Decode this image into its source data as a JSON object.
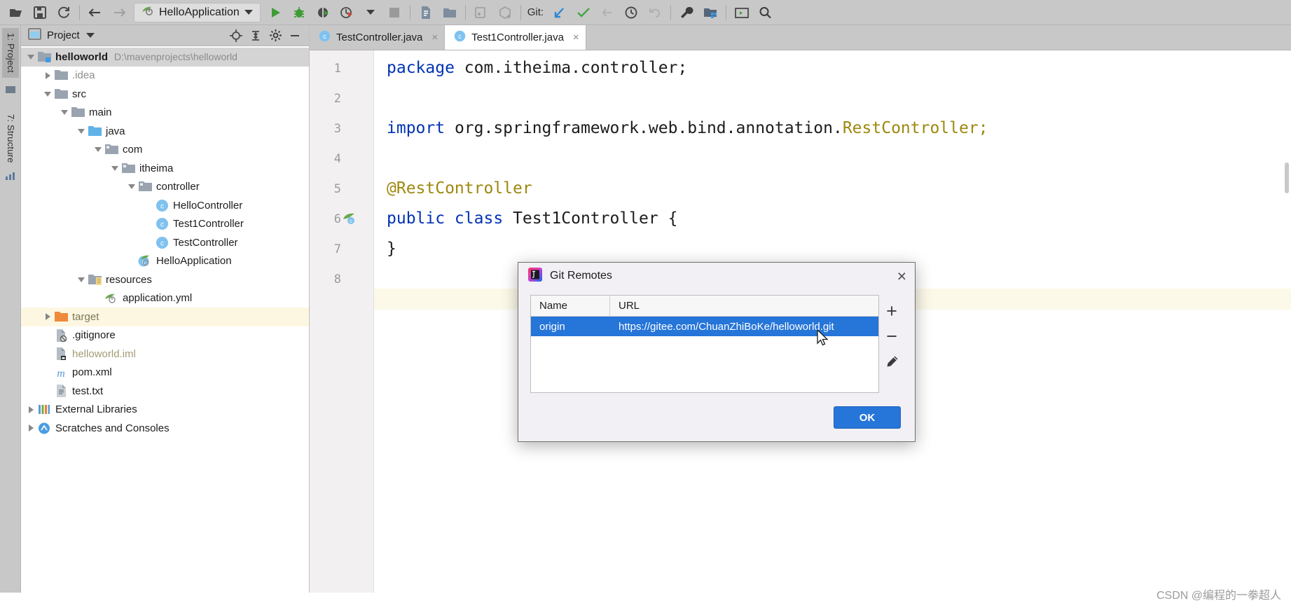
{
  "toolbar": {
    "icons": [
      {
        "name": "open-folder-icon",
        "glyph": "open-folder"
      },
      {
        "name": "save-all-icon",
        "glyph": "floppy"
      },
      {
        "name": "sync-refresh-icon",
        "glyph": "refresh"
      },
      {
        "name": "navigate-back-icon",
        "glyph": "arrow-left"
      },
      {
        "name": "navigate-forward-icon",
        "glyph": "arrow-right"
      }
    ],
    "run_config_name": "HelloApplication",
    "run_config_icon": "spring-boot-icon",
    "run_label": "Run",
    "debug_label": "Debug",
    "coverage_label": "Run with Coverage",
    "profile_label": "Profile",
    "stop_label": "Stop",
    "git_label": "Git:",
    "git_actions": [
      "update-project",
      "commit",
      "push",
      "history",
      "rollback"
    ],
    "right_icons": [
      "settings-wrench-icon",
      "project-structure-icon",
      "terminal-icon",
      "search-icon"
    ]
  },
  "stripe": {
    "project_tab": "1: Project",
    "structure_tab": "7: Structure"
  },
  "project_panel": {
    "header_title": "Project",
    "header_icons": [
      "locate-target-icon",
      "collapse-all-icon",
      "settings-gear-icon",
      "hide-panel-icon"
    ],
    "tree": [
      {
        "depth": 0,
        "twisty": "down",
        "icon": "module-folder-icon",
        "label": "helloworld",
        "bold": true,
        "path": "D:\\mavenprojects\\helloworld",
        "row": "sel-grey"
      },
      {
        "depth": 1,
        "twisty": "right",
        "icon": "folder-icon",
        "label": ".idea",
        "style": "grey"
      },
      {
        "depth": 1,
        "twisty": "down",
        "icon": "folder-icon",
        "label": "src"
      },
      {
        "depth": 2,
        "twisty": "down",
        "icon": "folder-icon",
        "label": "main"
      },
      {
        "depth": 3,
        "twisty": "down",
        "icon": "source-root-icon",
        "label": "java"
      },
      {
        "depth": 4,
        "twisty": "down",
        "icon": "package-icon",
        "label": "com"
      },
      {
        "depth": 5,
        "twisty": "down",
        "icon": "package-icon",
        "label": "itheima"
      },
      {
        "depth": 6,
        "twisty": "down",
        "icon": "package-icon",
        "label": "controller"
      },
      {
        "depth": 7,
        "twisty": "none",
        "icon": "java-class-icon",
        "label": "HelloController"
      },
      {
        "depth": 7,
        "twisty": "none",
        "icon": "java-class-icon",
        "label": "Test1Controller"
      },
      {
        "depth": 7,
        "twisty": "none",
        "icon": "java-class-icon",
        "label": "TestController"
      },
      {
        "depth": 6,
        "twisty": "none",
        "icon": "spring-boot-class-icon",
        "label": "HelloApplication"
      },
      {
        "depth": 3,
        "twisty": "down",
        "icon": "resources-root-icon",
        "label": "resources"
      },
      {
        "depth": 4,
        "twisty": "none",
        "icon": "yaml-spring-icon",
        "label": "application.yml"
      },
      {
        "depth": 1,
        "twisty": "right",
        "icon": "excluded-folder-icon",
        "label": "target",
        "style": "olive",
        "row": "hl-yellow"
      },
      {
        "depth": 1,
        "twisty": "none",
        "icon": "ignored-file-icon",
        "label": ".gitignore"
      },
      {
        "depth": 1,
        "twisty": "none",
        "icon": "iml-file-icon",
        "label": "helloworld.iml",
        "style": "tan"
      },
      {
        "depth": 1,
        "twisty": "none",
        "icon": "maven-pom-icon",
        "label": "pom.xml"
      },
      {
        "depth": 1,
        "twisty": "none",
        "icon": "text-file-icon",
        "label": "test.txt"
      },
      {
        "depth": 0,
        "twisty": "right",
        "icon": "libraries-icon",
        "label": "External Libraries"
      },
      {
        "depth": 0,
        "twisty": "right",
        "icon": "scratches-icon",
        "label": "Scratches and Consoles"
      }
    ]
  },
  "editor": {
    "tabs": [
      {
        "label": "TestController.java",
        "icon": "java-class-icon",
        "active": false,
        "close": "×"
      },
      {
        "label": "Test1Controller.java",
        "icon": "java-class-icon",
        "active": true,
        "close": "×"
      }
    ],
    "line_numbers": [
      "1",
      "2",
      "3",
      "4",
      "5",
      "6",
      "7",
      "8"
    ],
    "gutter_icons": [
      {
        "line": 6,
        "name": "spring-bean-icon"
      }
    ],
    "code_lines": [
      {
        "line": 1,
        "tokens": [
          {
            "t": "package ",
            "c": "kw"
          },
          {
            "t": "com.itheima.controller;",
            "c": "id"
          }
        ]
      },
      {
        "line": 2,
        "tokens": []
      },
      {
        "line": 3,
        "tokens": [
          {
            "t": "import ",
            "c": "kw"
          },
          {
            "t": "org.springframework.web.bind.annotation.",
            "c": "id"
          },
          {
            "t": "RestController;",
            "c": "ann"
          }
        ]
      },
      {
        "line": 4,
        "tokens": []
      },
      {
        "line": 5,
        "tokens": [
          {
            "t": "@RestController",
            "c": "ann"
          }
        ]
      },
      {
        "line": 6,
        "tokens": [
          {
            "t": "public class ",
            "c": "kw"
          },
          {
            "t": "Test1Controller {",
            "c": "id"
          }
        ]
      },
      {
        "line": 7,
        "tokens": [
          {
            "t": "}",
            "c": "id"
          }
        ]
      },
      {
        "line": 8,
        "tokens": []
      }
    ]
  },
  "dialog": {
    "title": "Git Remotes",
    "title_icon": "intellij-idea-icon",
    "close_glyph": "×",
    "columns": [
      "Name",
      "URL"
    ],
    "rows": [
      {
        "name": "origin",
        "url": "https://gitee.com/ChuanZhiBoKe/helloworld.git",
        "selected": true
      }
    ],
    "side_buttons": [
      {
        "name": "add-remote-button",
        "glyph": "+"
      },
      {
        "name": "remove-remote-button",
        "glyph": "−"
      },
      {
        "name": "edit-remote-button",
        "glyph": "pencil"
      }
    ],
    "ok_label": "OK",
    "accent_color": "#2675d9"
  },
  "watermark": "CSDN @编程的一拳超人"
}
